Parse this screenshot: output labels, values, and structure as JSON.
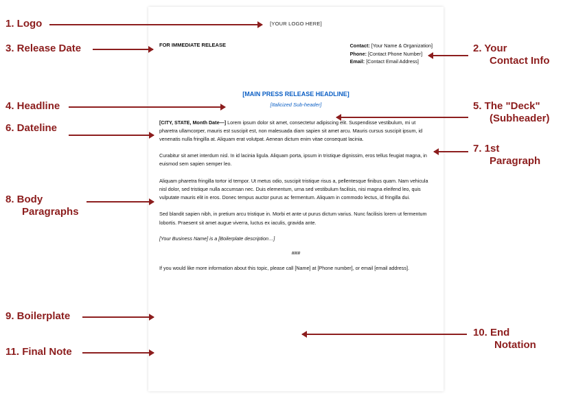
{
  "annotations": {
    "a1": "1. Logo",
    "a2a": "2. Your",
    "a2b": "Contact Info",
    "a3": "3. Release Date",
    "a4": "4. Headline",
    "a5a": "5. The \"Deck\"",
    "a5b": "(Subheader)",
    "a6": "6. Dateline",
    "a7a": "7. 1st",
    "a7b": "Paragraph",
    "a8a": "8. Body",
    "a8b": "Paragraphs",
    "a9": "9. Boilerplate",
    "a10a": "10. End",
    "a10b": "Notation",
    "a11": "11. Final Note"
  },
  "doc": {
    "logo": "[YOUR LOGO HERE]",
    "releaseLabel": "FOR IMMEDIATE RELEASE",
    "contact": {
      "contactLabel": "Contact:",
      "contactValue": "[Your Name & Organization]",
      "phoneLabel": "Phone:",
      "phoneValue": "[Contact Phone Number]",
      "emailLabel": "Email:",
      "emailValue": "[Contact Email Address]"
    },
    "headline": "[MAIN PRESS RELEASE HEADLINE]",
    "subheader": "[Italicized Sub-header]",
    "dateline": "[CITY, STATE, Month Date—]",
    "p1rest": " Lorem ipsum dolor sit amet, consectetur adipiscing elit. Suspendisse vestibulum, mi ut pharetra ullamcorper, mauris est suscipit est, non malesuada diam sapien sit amet arcu. Mauris cursus suscipit ipsum, id venenatis nulla fringilla at. Aliquam erat volutpat. Aenean dictum enim vitae consequat lacinia.",
    "p2": "Curabitur sit amet interdum nisl. In id lacinia ligula. Aliquam porta, ipsum in tristique dignissim, eros tellus feugiat magna, in euismod sem sapien semper leo.",
    "p3": "Aliquam pharetra fringilla tortor id tempor. Ut metus odio, suscipit tristique risus a, pellentesque finibus quam. Nam vehicula nisl dolor, sed tristique nulla accumsan nec. Duis elementum, urna sed vestibulum facilisis, nisi magna eleifend leo, quis vulputate mauris elit in eros. Donec tempus auctor purus ac fermentum. Aliquam in commodo lectus, id fringilla dui.",
    "p4": "Sed blandit sapien nibh, in pretium arcu tristique in. Morbi et ante ut purus dictum varius. Nunc facilisis lorem ut fermentum lobortis. Praesent sit amet augue viverra, luctus ex iaculis, gravida ante.",
    "boilerplate": "[Your Business Name] is a [Boilerplate description…]",
    "endNotation": "###",
    "finalNote": "If you would like more information about this topic, please call [Name] at [Phone number], or email [email address]."
  }
}
